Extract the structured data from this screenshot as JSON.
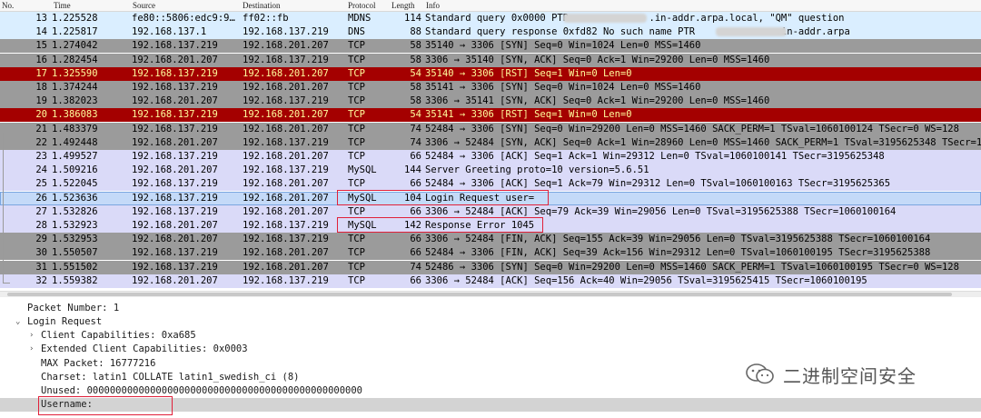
{
  "columns": {
    "no": "No.",
    "time": "Time",
    "source": "Source",
    "destination": "Destination",
    "protocol": "Protocol",
    "length": "Length",
    "info": "Info"
  },
  "colors": {
    "normal": "#9b9b9b",
    "highlight_red": "#a40000",
    "highlight_text": "#fffc9c",
    "purple": "#dadaf8",
    "light": "#daeeff",
    "selected": "#c4daf8",
    "accent_box": "#e0203a"
  },
  "packets": [
    {
      "no": "13",
      "time": "1.225528",
      "source": "fe80::5806:edc9:9…",
      "destination": "ff02::fb",
      "protocol": "MDNS",
      "length": "114",
      "info": "Standard query 0x0000 PTR              .in-addr.arpa.local, \"QM\" question",
      "style": "light"
    },
    {
      "no": "14",
      "time": "1.225817",
      "source": "192.168.137.1",
      "destination": "192.168.137.219",
      "protocol": "DNS",
      "length": "88",
      "info": "Standard query response 0xfd82 No such name PTR              .in-addr.arpa",
      "style": "light"
    },
    {
      "no": "15",
      "time": "1.274042",
      "source": "192.168.137.219",
      "destination": "192.168.201.207",
      "protocol": "TCP",
      "length": "58",
      "info": "35140 → 3306 [SYN] Seq=0 Win=1024 Len=0 MSS=1460",
      "style": "normal"
    },
    {
      "no": "16",
      "time": "1.282454",
      "source": "192.168.201.207",
      "destination": "192.168.137.219",
      "protocol": "TCP",
      "length": "58",
      "info": "3306 → 35140 [SYN, ACK] Seq=0 Ack=1 Win=29200 Len=0 MSS=1460",
      "style": "normal"
    },
    {
      "no": "17",
      "time": "1.325590",
      "source": "192.168.137.219",
      "destination": "192.168.201.207",
      "protocol": "TCP",
      "length": "54",
      "info": "35140 → 3306 [RST] Seq=1 Win=0 Len=0",
      "style": "red"
    },
    {
      "no": "18",
      "time": "1.374244",
      "source": "192.168.137.219",
      "destination": "192.168.201.207",
      "protocol": "TCP",
      "length": "58",
      "info": "35141 → 3306 [SYN] Seq=0 Win=1024 Len=0 MSS=1460",
      "style": "normal"
    },
    {
      "no": "19",
      "time": "1.382023",
      "source": "192.168.201.207",
      "destination": "192.168.137.219",
      "protocol": "TCP",
      "length": "58",
      "info": "3306 → 35141 [SYN, ACK] Seq=0 Ack=1 Win=29200 Len=0 MSS=1460",
      "style": "normal"
    },
    {
      "no": "20",
      "time": "1.386083",
      "source": "192.168.137.219",
      "destination": "192.168.201.207",
      "protocol": "TCP",
      "length": "54",
      "info": "35141 → 3306 [RST] Seq=1 Win=0 Len=0",
      "style": "red"
    },
    {
      "no": "21",
      "time": "1.483379",
      "source": "192.168.137.219",
      "destination": "192.168.201.207",
      "protocol": "TCP",
      "length": "74",
      "info": "52484 → 3306 [SYN] Seq=0 Win=29200 Len=0 MSS=1460 SACK_PERM=1 TSval=1060100124 TSecr=0 WS=128",
      "style": "normal"
    },
    {
      "no": "22",
      "time": "1.492448",
      "source": "192.168.201.207",
      "destination": "192.168.137.219",
      "protocol": "TCP",
      "length": "74",
      "info": "3306 → 52484 [SYN, ACK] Seq=0 Ack=1 Win=28960 Len=0 MSS=1460 SACK_PERM=1 TSval=3195625348 TSecr=106",
      "style": "normal"
    },
    {
      "no": "23",
      "time": "1.499527",
      "source": "192.168.137.219",
      "destination": "192.168.201.207",
      "protocol": "TCP",
      "length": "66",
      "info": "52484 → 3306 [ACK] Seq=1 Ack=1 Win=29312 Len=0 TSval=1060100141 TSecr=3195625348",
      "style": "purple"
    },
    {
      "no": "24",
      "time": "1.509216",
      "source": "192.168.201.207",
      "destination": "192.168.137.219",
      "protocol": "MySQL",
      "length": "144",
      "info": "Server Greeting proto=10 version=5.6.51",
      "style": "purple"
    },
    {
      "no": "25",
      "time": "1.522045",
      "source": "192.168.137.219",
      "destination": "192.168.201.207",
      "protocol": "TCP",
      "length": "66",
      "info": "52484 → 3306 [ACK] Seq=1 Ack=79 Win=29312 Len=0 TSval=1060100163 TSecr=3195625365",
      "style": "purple"
    },
    {
      "no": "26",
      "time": "1.523636",
      "source": "192.168.137.219",
      "destination": "192.168.201.207",
      "protocol": "MySQL",
      "length": "104",
      "info": "Login Request user=",
      "style": "selected"
    },
    {
      "no": "27",
      "time": "1.532826",
      "source": "192.168.137.219",
      "destination": "192.168.201.207",
      "protocol": "TCP",
      "length": "66",
      "info": "3306 → 52484 [ACK] Seq=79 Ack=39 Win=29056 Len=0 TSval=3195625388 TSecr=1060100164",
      "style": "purple"
    },
    {
      "no": "28",
      "time": "1.532923",
      "source": "192.168.201.207",
      "destination": "192.168.137.219",
      "protocol": "MySQL",
      "length": "142",
      "info": "Response Error 1045",
      "style": "purple"
    },
    {
      "no": "29",
      "time": "1.532953",
      "source": "192.168.201.207",
      "destination": "192.168.137.219",
      "protocol": "TCP",
      "length": "66",
      "info": "3306 → 52484 [FIN, ACK] Seq=155 Ack=39 Win=29056 Len=0 TSval=3195625388 TSecr=1060100164",
      "style": "normal"
    },
    {
      "no": "30",
      "time": "1.550507",
      "source": "192.168.137.219",
      "destination": "192.168.201.207",
      "protocol": "TCP",
      "length": "66",
      "info": "52484 → 3306 [FIN, ACK] Seq=39 Ack=156 Win=29312 Len=0 TSval=1060100195 TSecr=3195625388",
      "style": "normal"
    },
    {
      "no": "31",
      "time": "1.551502",
      "source": "192.168.137.219",
      "destination": "192.168.201.207",
      "protocol": "TCP",
      "length": "74",
      "info": "52486 → 3306 [SYN] Seq=0 Win=29200 Len=0 MSS=1460 SACK_PERM=1 TSval=1060100195 TSecr=0 WS=128",
      "style": "normal"
    },
    {
      "no": "32",
      "time": "1.559382",
      "source": "192.168.201.207",
      "destination": "192.168.137.219",
      "protocol": "TCP",
      "length": "66",
      "info": "3306 → 52484 [ACK] Seq=156 Ack=40 Win=29056 TSval=3195625415 TSecr=1060100195",
      "style": "purple"
    }
  ],
  "details": [
    {
      "text": "Packet Number: 1",
      "arrow": ""
    },
    {
      "text": "Login Request",
      "arrow": "v"
    },
    {
      "text": "Client Capabilities: 0xa685",
      "arrow": ">"
    },
    {
      "text": "Extended Client Capabilities: 0x0003",
      "arrow": ">"
    },
    {
      "text": "MAX Packet: 16777216",
      "arrow": ""
    },
    {
      "text": "Charset: latin1 COLLATE latin1_swedish_ci (8)",
      "arrow": ""
    },
    {
      "text": "Unused: 000000000000000000000000000000000000000000000000",
      "arrow": ""
    },
    {
      "text": "Username:",
      "arrow": ""
    }
  ],
  "watermark": {
    "text": "二进制空间安全",
    "icon": "wechat-icon"
  }
}
